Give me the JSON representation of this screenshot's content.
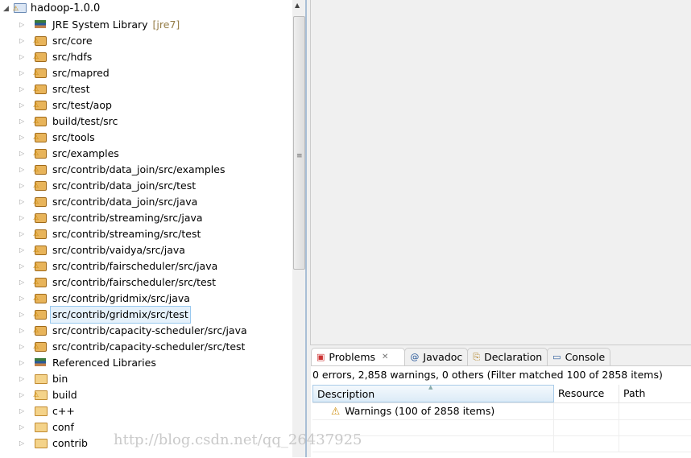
{
  "tree": {
    "root": {
      "label": "hadoop-1.0.0",
      "icon": "project-icon"
    },
    "items": [
      {
        "label": "JRE System Library",
        "decoration": "[jre7]",
        "icon": "library-icon"
      },
      {
        "label": "src/core",
        "icon": "package-folder-icon"
      },
      {
        "label": "src/hdfs",
        "icon": "package-folder-icon"
      },
      {
        "label": "src/mapred",
        "icon": "package-folder-icon"
      },
      {
        "label": "src/test",
        "icon": "package-folder-icon"
      },
      {
        "label": "src/test/aop",
        "icon": "package-folder-icon"
      },
      {
        "label": "build/test/src",
        "icon": "package-folder-icon"
      },
      {
        "label": "src/tools",
        "icon": "package-folder-icon"
      },
      {
        "label": "src/examples",
        "icon": "package-folder-icon"
      },
      {
        "label": "src/contrib/data_join/src/examples",
        "icon": "package-folder-icon"
      },
      {
        "label": "src/contrib/data_join/src/test",
        "icon": "package-folder-icon"
      },
      {
        "label": "src/contrib/data_join/src/java",
        "icon": "package-folder-icon"
      },
      {
        "label": "src/contrib/streaming/src/java",
        "icon": "package-folder-icon"
      },
      {
        "label": "src/contrib/streaming/src/test",
        "icon": "package-folder-icon"
      },
      {
        "label": "src/contrib/vaidya/src/java",
        "icon": "package-folder-icon"
      },
      {
        "label": "src/contrib/fairscheduler/src/java",
        "icon": "package-folder-icon"
      },
      {
        "label": "src/contrib/fairscheduler/src/test",
        "icon": "package-folder-icon"
      },
      {
        "label": "src/contrib/gridmix/src/java",
        "icon": "package-folder-icon"
      },
      {
        "label": "src/contrib/gridmix/src/test",
        "icon": "package-folder-icon",
        "selected": true
      },
      {
        "label": "src/contrib/capacity-scheduler/src/java",
        "icon": "package-folder-icon"
      },
      {
        "label": "src/contrib/capacity-scheduler/src/test",
        "icon": "package-folder-icon"
      },
      {
        "label": "Referenced Libraries",
        "icon": "library-icon"
      },
      {
        "label": "bin",
        "icon": "folder-icon"
      },
      {
        "label": "build",
        "icon": "folder-icon",
        "warning": true
      },
      {
        "label": "c++",
        "icon": "folder-icon"
      },
      {
        "label": "conf",
        "icon": "folder-icon"
      },
      {
        "label": "contrib",
        "icon": "folder-icon"
      }
    ]
  },
  "problems": {
    "tabs": [
      {
        "label": "Problems",
        "icon": "problems-icon",
        "active": true
      },
      {
        "label": "Javadoc",
        "icon": "at-icon"
      },
      {
        "label": "Declaration",
        "icon": "declaration-icon"
      },
      {
        "label": "Console",
        "icon": "console-icon"
      }
    ],
    "summary": "0 errors, 2,858 warnings, 0 others (Filter matched 100 of 2858 items)",
    "columns": [
      "Description",
      "Resource",
      "Path"
    ],
    "rows": [
      {
        "description": "Warnings (100 of 2858 items)",
        "icon": "warning-icon"
      }
    ]
  },
  "watermark": "http://blog.csdn.net/qq_26437925"
}
